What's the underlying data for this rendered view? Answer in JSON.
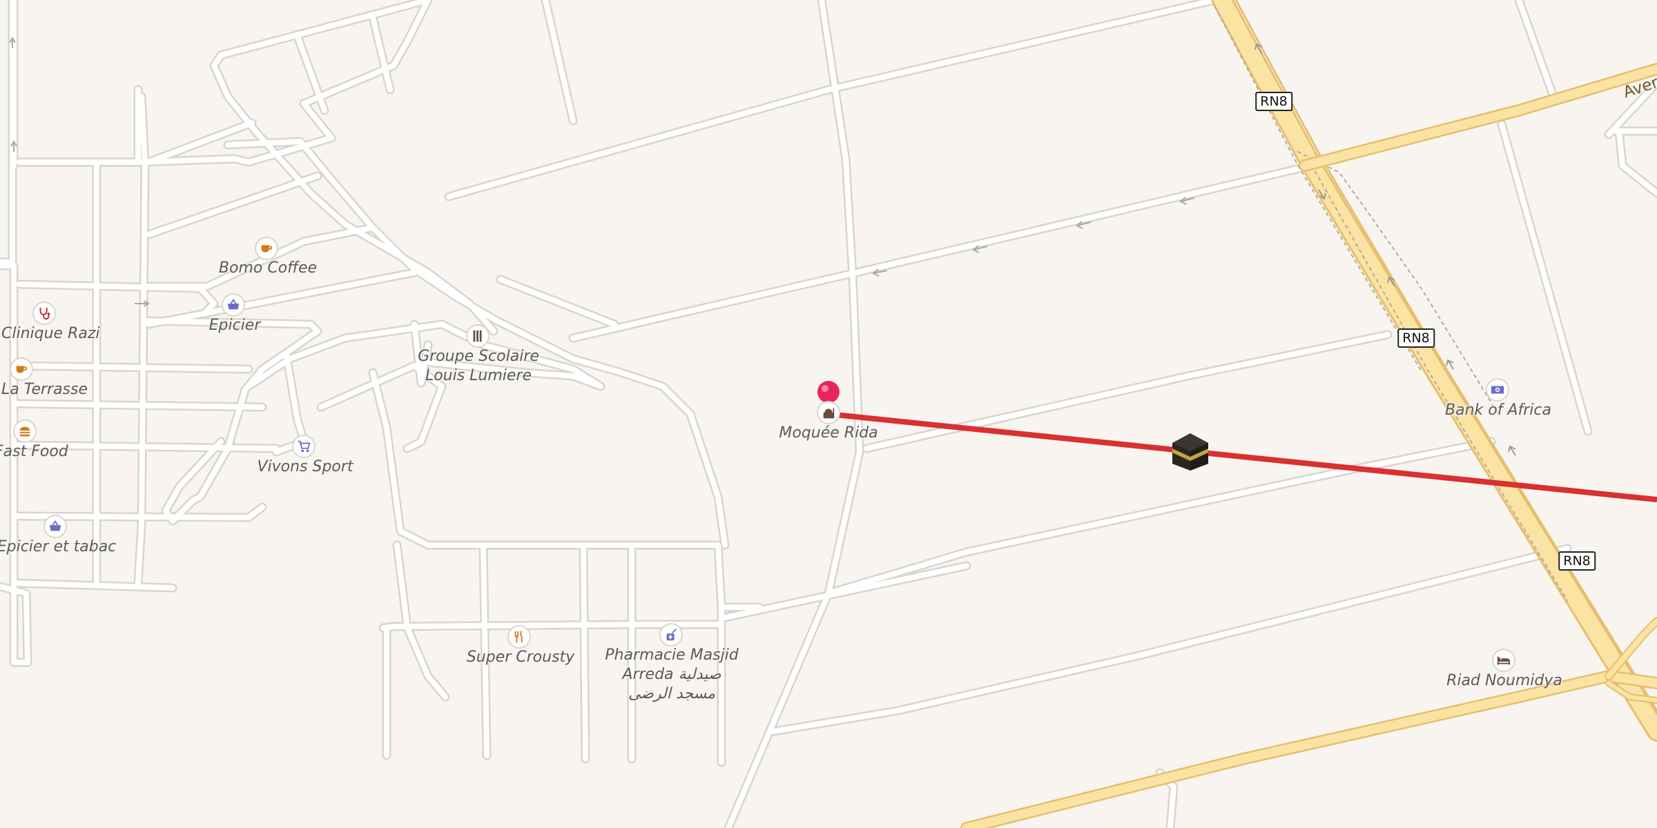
{
  "map": {
    "pois": [
      {
        "id": "bomo_coffee",
        "label": "Bomo Coffee",
        "icon": "coffee-cup-icon",
        "color": "#d47a12"
      },
      {
        "id": "epicier1",
        "label": "Epicier",
        "icon": "shopping-basket-icon",
        "color": "#6b6bc6"
      },
      {
        "id": "clinique_razi",
        "label": "Clinique Razi",
        "icon": "stethoscope-icon",
        "color": "#b3272b"
      },
      {
        "id": "la_terrasse",
        "label": "La Terrasse",
        "icon": "coffee-cup-icon",
        "color": "#d47a12"
      },
      {
        "id": "fast_food",
        "label": "Fast Food",
        "icon": "burger-icon",
        "color": "#d47a12"
      },
      {
        "id": "epicier_tabac",
        "label": "Epicier et tabac",
        "icon": "shopping-basket-icon",
        "color": "#6b6bc6"
      },
      {
        "id": "groupe_scolaire",
        "label_line1": "Groupe Scolaire",
        "label_line2": "Louis Lumiere",
        "icon": "school-icon",
        "color": "#6a4a3a"
      },
      {
        "id": "vivons_sport",
        "label": "Vivons Sport",
        "icon": "shopping-cart-icon",
        "color": "#6b6bc6"
      },
      {
        "id": "mosquee_rida",
        "label": "Moquée Rida",
        "icon": "mosque-icon",
        "color": "#6a4a3a"
      },
      {
        "id": "super_crousty",
        "label": "Super Crousty",
        "icon": "fork-knife-icon",
        "color": "#d47a12"
      },
      {
        "id": "pharmacie",
        "label_line1": "Pharmacie Masjid",
        "label_line2": "Arreda صيدلية",
        "label_line3": "مسجد الرضى",
        "icon": "pharmacy-icon",
        "color": "#6b6bc6"
      },
      {
        "id": "bank_of_africa",
        "label": "Bank of Africa",
        "icon": "banknote-icon",
        "color": "#6b6bc6"
      },
      {
        "id": "riad_noumidya",
        "label": "Riad Noumidya",
        "icon": "bed-icon",
        "color": "#6a4a3a"
      }
    ],
    "road_shields": [
      "RN8",
      "RN8",
      "RN8"
    ],
    "road_name": "Aver",
    "colors": {
      "background": "#f8f5f1",
      "minor_road": "#ffffff",
      "road_casing": "#d8d4cf",
      "highway": "#fbe3a4",
      "highway_casing": "#e5bf6c",
      "qibla_line": "#d93030",
      "pin": "#e8245a"
    },
    "markers": {
      "location_pin": "location-pin-icon",
      "kaaba": "kaaba-icon"
    }
  }
}
